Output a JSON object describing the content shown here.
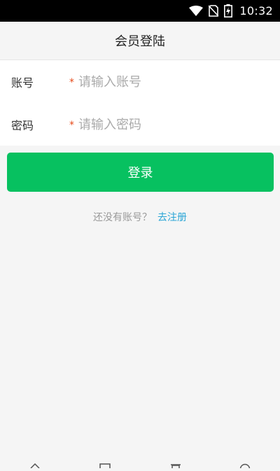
{
  "status_bar": {
    "time": "10:32",
    "icons": [
      "wifi-icon",
      "no-sim-icon",
      "battery-charging-icon"
    ]
  },
  "header": {
    "title": "会员登陆"
  },
  "form": {
    "account": {
      "label": "账号",
      "required_mark": "*",
      "placeholder": "请输入账号",
      "value": ""
    },
    "password": {
      "label": "密码",
      "required_mark": "*",
      "placeholder": "请输入密码",
      "value": ""
    }
  },
  "login_button": {
    "label": "登录"
  },
  "register": {
    "question": "还没有账号？",
    "link": "去注册"
  },
  "nav_bar": {
    "icons": [
      "home-icon",
      "window-icon",
      "trash-icon",
      "circle-icon"
    ]
  },
  "colors": {
    "accent": "#07c160",
    "link": "#2aa5d6",
    "required": "#e64a19",
    "background": "#f5f5f5"
  }
}
